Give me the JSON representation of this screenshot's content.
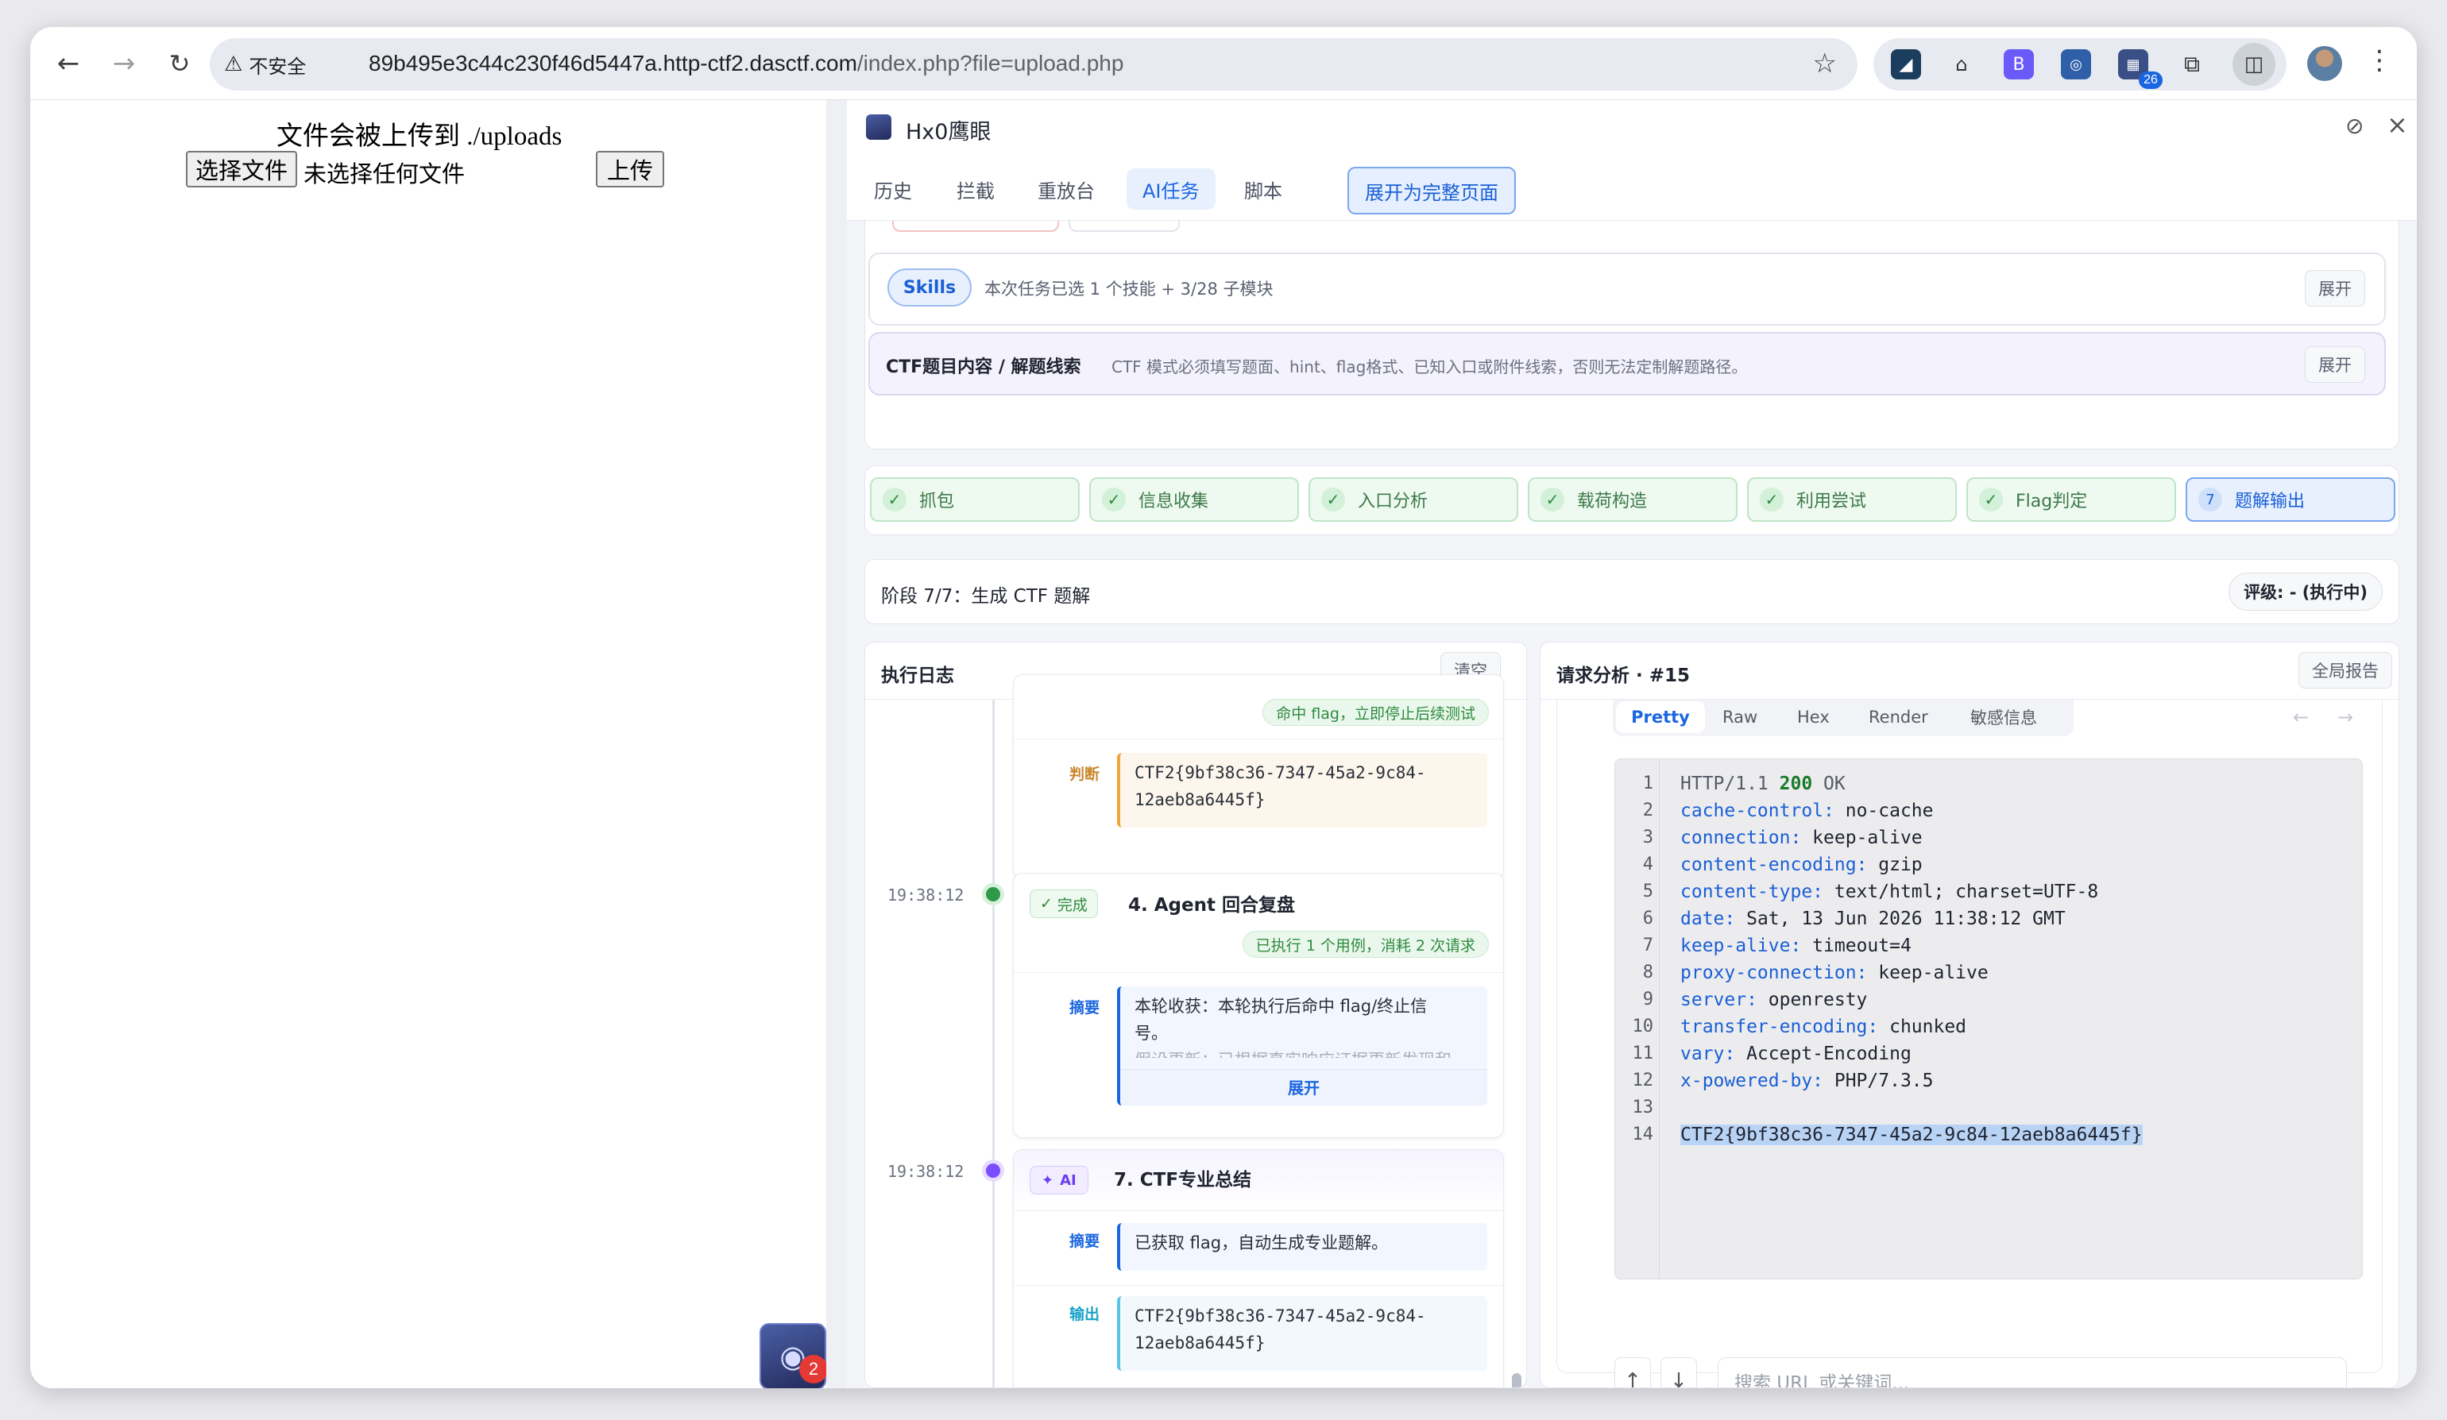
{
  "browser": {
    "security_label": "不安全",
    "url_host": "89b495e3c44c230f46d5447a.http-ctf2.dasctf.com",
    "url_path": "/index.php?file=upload.php",
    "ext_badge": "26"
  },
  "page": {
    "heading": "文件会被上传到 ./uploads",
    "choose_file": "选择文件",
    "no_file": "未选择任何文件",
    "upload": "上传",
    "float_badge": "2"
  },
  "panel": {
    "title": "Hx0鹰眼",
    "tabs": [
      "历史",
      "拦截",
      "重放台",
      "AI任务",
      "脚本"
    ],
    "expand_page": "展开为完整页面",
    "skills": {
      "label": "Skills",
      "desc": "本次任务已选 1 个技能 + 3/28 子模块",
      "expand": "展开"
    },
    "ctf": {
      "label": "CTF题目内容 / 解题线索",
      "desc": "CTF 模式必须填写题面、hint、flag格式、已知入口或附件线索，否则无法定制解题路径。",
      "expand": "展开"
    },
    "stages": [
      "抓包",
      "信息收集",
      "入口分析",
      "载荷构造",
      "利用尝试",
      "Flag判定",
      "题解输出"
    ],
    "current_stage_num": "7",
    "phase_text": "阶段 7/7：生成 CTF 题解",
    "rating": "评级: - (执行中)"
  },
  "log": {
    "title": "执行日志",
    "clear": "清空",
    "entry1": {
      "tag": "命中 flag，立即停止后续测试",
      "field_label": "判断",
      "field_value": "CTF2{9bf38c36-7347-45a2-9c84-12aeb8a6445f}"
    },
    "entry2": {
      "time": "19:38:12",
      "badge": "完成",
      "title": "4. Agent 回合复盘",
      "tag": "已执行 1 个用例，消耗 2 次请求",
      "field_label": "摘要",
      "line1": "本轮收获：本轮执行后命中 flag/终止信",
      "line2": "号。",
      "line3": "假设更新：已根据真实响应证据更新发现和",
      "expand": "展开"
    },
    "entry3": {
      "time": "19:38:12",
      "badge": "AI",
      "title": "7. CTF专业总结",
      "summary_label": "摘要",
      "summary": "已获取 flag，自动生成专业题解。",
      "output_label": "输出",
      "output": "CTF2{9bf38c36-7347-45a2-9c84-12aeb8a6445f}"
    }
  },
  "request": {
    "title": "请求分析 · #15",
    "report": "全局报告",
    "view_tabs": [
      "Pretty",
      "Raw",
      "Hex",
      "Render",
      "敏感信息"
    ],
    "lines": [
      {
        "num": "1",
        "k": "HTTP/1.1 ",
        "v": "200",
        "rest": " OK"
      },
      {
        "num": "2",
        "k": "cache-control:",
        "rest": " no-cache"
      },
      {
        "num": "3",
        "k": "connection:",
        "rest": " keep-alive"
      },
      {
        "num": "4",
        "k": "content-encoding:",
        "rest": " gzip"
      },
      {
        "num": "5",
        "k": "content-type:",
        "rest": " text/html; charset=UTF-8"
      },
      {
        "num": "6",
        "k": "date:",
        "rest": " Sat, 13 Jun 2026 11:38:12 GMT"
      },
      {
        "num": "7",
        "k": "keep-alive:",
        "rest": " timeout=4"
      },
      {
        "num": "8",
        "k": "proxy-connection:",
        "rest": " keep-alive"
      },
      {
        "num": "9",
        "k": "server:",
        "rest": " openresty"
      },
      {
        "num": "10",
        "k": "transfer-encoding:",
        "rest": " chunked"
      },
      {
        "num": "11",
        "k": "vary:",
        "rest": " Accept-Encoding"
      },
      {
        "num": "12",
        "k": "x-powered-by:",
        "rest": " PHP/7.3.5"
      },
      {
        "num": "13",
        "k": "",
        "rest": ""
      },
      {
        "num": "14",
        "k": "",
        "rest": "CTF2{9bf38c36-7347-45a2-9c84-12aeb8a6445f}"
      }
    ],
    "search_placeholder": "搜索 URL 或关键词..."
  },
  "colors": {
    "accent": "#1a66e0",
    "success": "#2e8b3f",
    "ai": "#7c4dff",
    "orange": "#f0a33a"
  }
}
